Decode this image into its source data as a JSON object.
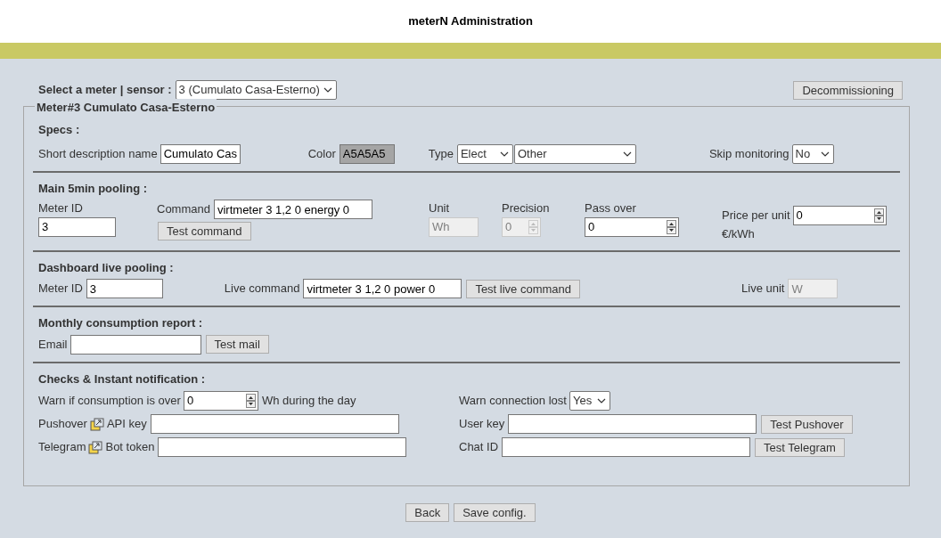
{
  "header": {
    "title": "meterN Administration"
  },
  "meter_select": {
    "label": "Select a meter | sensor :",
    "value": "3 (Cumulato Casa-Esterno)"
  },
  "decommissioning_button": "Decommissioning",
  "legend": "Meter#3 Cumulato Casa-Esterno",
  "specs": {
    "title": "Specs :",
    "description": {
      "label": "Short description name",
      "value": "Cumulato Cas"
    },
    "color": {
      "label": "Color",
      "value": "A5A5A5"
    },
    "type": {
      "label": "Type",
      "value": "Elect",
      "subtype": "Other"
    },
    "skip_monitoring": {
      "label": "Skip monitoring",
      "value": "No"
    }
  },
  "main_pooling": {
    "title": "Main 5min pooling :",
    "meter_id": {
      "label": "Meter ID",
      "value": "3",
      "disabled": false
    },
    "command": {
      "label": "Command",
      "value": "virtmeter 3 1,2 0 energy 0",
      "disabled": false
    },
    "test_button": "Test command",
    "unit": {
      "label": "Unit",
      "value": "Wh",
      "disabled": true
    },
    "precision": {
      "label": "Precision",
      "value": "0",
      "disabled": true
    },
    "pass_over": {
      "label": "Pass over",
      "value": "0",
      "disabled": false
    },
    "price": {
      "label": "Price per unit",
      "value": "0",
      "unit": "€/kWh",
      "disabled": false
    }
  },
  "live_pooling": {
    "title": "Dashboard live pooling :",
    "meter_id": {
      "label": "Meter ID",
      "value": "3",
      "disabled": false
    },
    "command": {
      "label": "Live command",
      "value": "virtmeter 3 1,2 0 power 0",
      "disabled": false
    },
    "test_button": "Test live command",
    "unit": {
      "label": "Live unit",
      "value": "W",
      "disabled": true
    }
  },
  "monthly_report": {
    "title": "Monthly consumption report :",
    "email": {
      "label": "Email"
    },
    "test_button": "Test mail"
  },
  "checks": {
    "title": "Checks & Instant notification :",
    "warn_over": {
      "label": "Warn if consumption is over",
      "value": "0",
      "suffix": "Wh during the day"
    },
    "connection_lost": {
      "label": "Warn connection lost",
      "value": "Yes"
    },
    "pushover": {
      "label": "Pushover",
      "key_label": "API key",
      "user_label": "User key",
      "test_button": "Test Pushover"
    },
    "telegram": {
      "label": "Telegram",
      "key_label": "Bot token",
      "user_label": "Chat ID",
      "test_button": "Test Telegram"
    }
  },
  "footer_buttons": [
    "Back",
    "Save config."
  ]
}
